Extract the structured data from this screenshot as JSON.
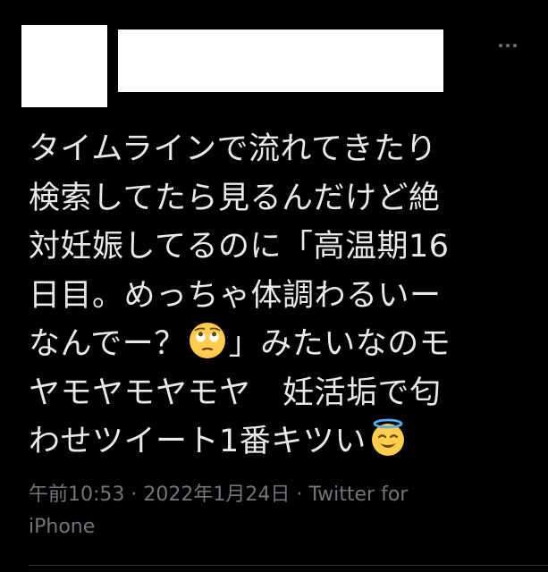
{
  "tweet": {
    "lines": [
      "タイムラインで流れてきたり",
      "検索してたら見るんだけど絶",
      "対妊娠してるのに「高温期16",
      "日目。めっちゃ体調わるいー",
      "なんでー？",
      "」みたいなのモ",
      "ヤモヤモヤモヤ　妊活垢で匂",
      "わせツイート1番キツい"
    ],
    "emoji_1": "face-with-rolling-eyes",
    "emoji_2": "smiling-face-with-halo"
  },
  "meta": {
    "time": "午前10:53",
    "separator": " · ",
    "date": "2022年1月24日",
    "source_line1": "Twitter for",
    "source_line2": "iPhone"
  },
  "colors": {
    "background": "#000000",
    "text": "#e7e9ea",
    "secondary": "#71767b",
    "divider": "#2f3336"
  }
}
